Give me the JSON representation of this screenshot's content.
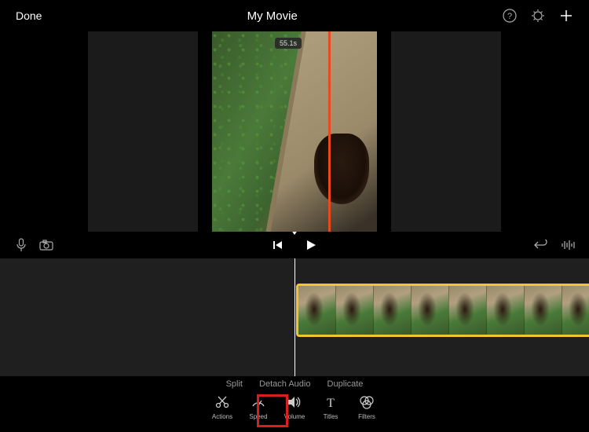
{
  "header": {
    "done": "Done",
    "title": "My Movie"
  },
  "preview": {
    "timecode": "55.1s"
  },
  "context_menu": {
    "split": "Split",
    "detach_audio": "Detach Audio",
    "duplicate": "Duplicate"
  },
  "tools": {
    "actions": "Actions",
    "speed": "Speed",
    "volume": "Volume",
    "titles": "Titles",
    "filters": "Filters"
  }
}
